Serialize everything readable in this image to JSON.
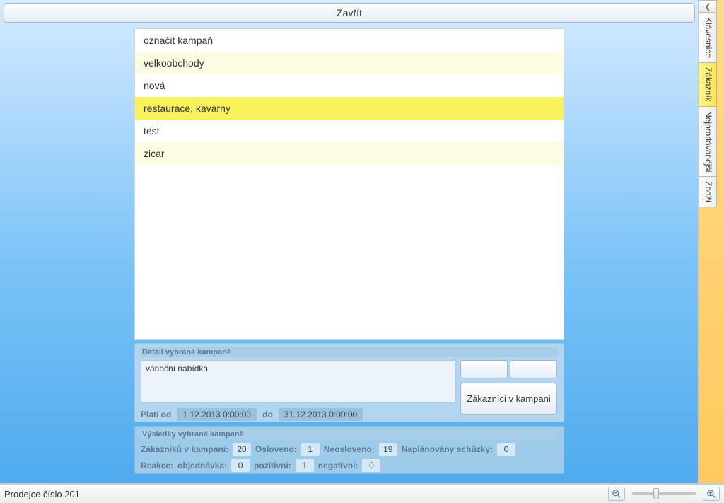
{
  "header": {
    "close_label": "Zavřít"
  },
  "campaigns": {
    "items": [
      {
        "label": "označit kampaň"
      },
      {
        "label": "velkoobchody"
      },
      {
        "label": "nová"
      },
      {
        "label": "restaurace, kavárny"
      },
      {
        "label": "test"
      },
      {
        "label": "zicar"
      }
    ],
    "selected_index": 3
  },
  "detail": {
    "title": "Detail vybrané kampaně",
    "note": "vánoční nabídka",
    "customers_btn": "Zákazníci v kampani",
    "valid_from_label": "Platí od",
    "valid_from": "1.12.2013 0:00:00",
    "valid_to_label": "do",
    "valid_to": "31.12.2013 0:00:00"
  },
  "results": {
    "title": "Výsledky vybrané kampaně",
    "customers_label": "Zákazníků v kampani:",
    "customers_val": "20",
    "addressed_label": "Osloveno:",
    "addressed_val": "1",
    "unaddressed_label": "Neosloveno:",
    "unaddressed_val": "19",
    "meetings_label": "Naplánovány schůzky:",
    "meetings_val": "0",
    "reaction_label": "Reakce:",
    "order_label": "objednávka:",
    "order_val": "0",
    "positive_label": "pozitivní:",
    "positive_val": "1",
    "negative_label": "negativní:",
    "negative_val": "0"
  },
  "side_tabs": {
    "t0": "Klávesnice",
    "t1": "Zákazník",
    "t2": "Nejprodávanější",
    "t3": "Zboží"
  },
  "status": {
    "text": "Prodejce číslo 201"
  }
}
